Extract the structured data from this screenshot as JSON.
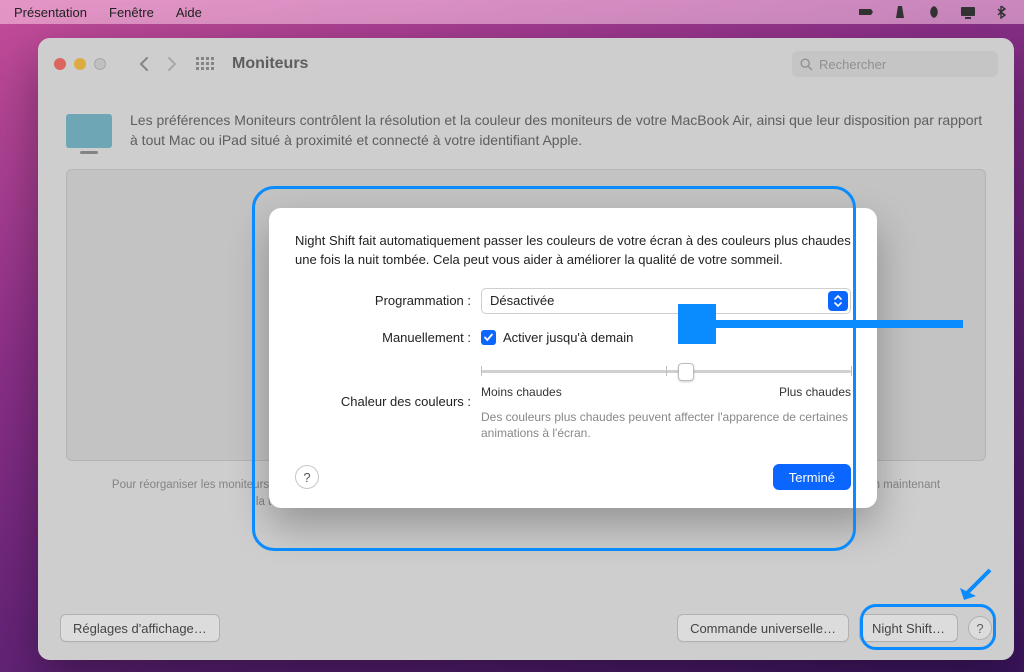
{
  "menubar": {
    "items": [
      "Présentation",
      "Fenêtre",
      "Aide"
    ]
  },
  "window": {
    "title": "Moniteurs",
    "search_placeholder": "Rechercher",
    "description": "Les préférences Moniteurs contrôlent la résolution et la couleur des moniteurs de votre MacBook Air, ainsi que leur disposition par rapport à tout Mac ou iPad situé à proximité et connecté à votre identifiant Apple.",
    "hint": "Pour réorganiser les moniteurs, faites-les glisser à la position souhaitée. Pour effectuer une recopie vidéo, faites glisser les moniteurs l'un sur l'autre en maintenant la touche Option enfoncée. Pour repositionner la barre des menus, faites-la glisser vers un autre moniteur.",
    "buttons": {
      "display_settings": "Réglages d'affichage…",
      "universal_control": "Commande universelle…",
      "night_shift": "Night Shift…"
    }
  },
  "sheet": {
    "intro": "Night Shift fait automatiquement passer les couleurs de votre écran à des couleurs plus chaudes une fois la nuit tombée. Cela peut vous aider à améliorer la qualité de votre sommeil.",
    "schedule_label": "Programmation :",
    "schedule_value": "Désactivée",
    "manual_label": "Manuellement :",
    "manual_checkbox": "Activer jusqu'à demain",
    "warmth_label": "Chaleur des couleurs :",
    "warmth_min": "Moins chaudes",
    "warmth_max": "Plus chaudes",
    "warmth_note": "Des couleurs plus chaudes peuvent affecter l'apparence de certaines animations à l'écran.",
    "done": "Terminé",
    "help": "?"
  }
}
